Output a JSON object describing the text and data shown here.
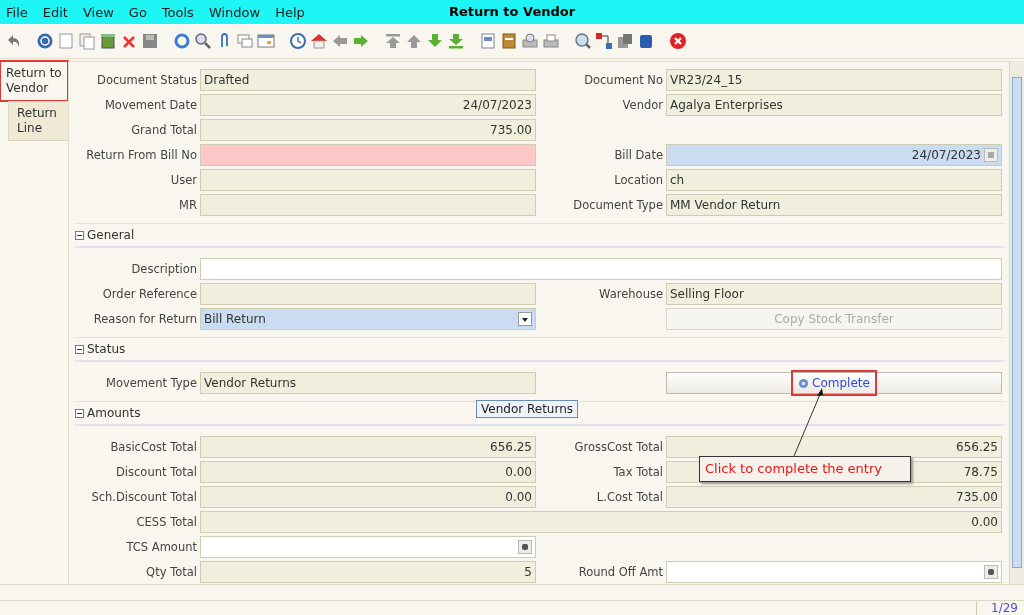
{
  "menu": [
    "File",
    "Edit",
    "View",
    "Go",
    "Tools",
    "Window",
    "Help"
  ],
  "window": {
    "title": "Return to Vendor"
  },
  "tabs": [
    {
      "label": "Return to Vendor",
      "selected": true,
      "highlighted": true
    },
    {
      "label": "Return Line",
      "selected": false,
      "highlighted": false
    }
  ],
  "sections": [
    {
      "rows": [
        {
          "left": {
            "kind": "readonly",
            "label": "Document Status",
            "value": "Drafted"
          },
          "right": {
            "kind": "readonly",
            "label": "Document No",
            "value": "VR23/24_15"
          }
        },
        {
          "left": {
            "kind": "readonly-number",
            "label": "Movement Date",
            "value": "24/07/2023"
          },
          "right": {
            "kind": "readonly",
            "label": "Vendor",
            "value": "Agalya Enterprises"
          }
        },
        {
          "left": {
            "kind": "readonly-number",
            "label": "Grand Total",
            "value": "735.00"
          }
        },
        {
          "left": {
            "kind": "mandatory",
            "label": "Return From Bill No"
          },
          "right": {
            "kind": "date",
            "label": "Bill Date",
            "value": "24/07/2023"
          }
        },
        {
          "left": {
            "kind": "readonly",
            "label": "User"
          },
          "right": {
            "kind": "readonly",
            "label": "Location",
            "value": "ch"
          }
        },
        {
          "left": {
            "kind": "readonly",
            "label": "MR"
          },
          "right": {
            "kind": "readonly",
            "label": "Document Type",
            "value": "MM Vendor Return"
          }
        }
      ]
    },
    {
      "title": "General",
      "expanded": true,
      "rows": [
        {
          "full": {
            "kind": "input",
            "label": "Description"
          }
        },
        {
          "left": {
            "kind": "readonly",
            "label": "Order Reference"
          },
          "right": {
            "kind": "readonly",
            "label": "Warehouse",
            "value": "Selling Floor"
          }
        },
        {
          "left": {
            "kind": "dropdown",
            "label": "Reason for Return",
            "value": "Bill Return"
          },
          "right": {
            "kind": "button",
            "label": "Copy Stock Transfer",
            "disabled": true
          }
        }
      ]
    },
    {
      "title": "Status",
      "expanded": true,
      "rows": [
        {
          "left": {
            "kind": "readonly",
            "label": "Movement Type",
            "value": "Vendor Returns"
          },
          "right": {
            "kind": "action",
            "label": "Complete",
            "disabled": false,
            "highlighted": true
          }
        }
      ]
    },
    {
      "title": "Amounts",
      "expanded": true,
      "rows": [
        {
          "left": {
            "kind": "readonly-number",
            "label": "BasicCost Total",
            "value": "656.25"
          },
          "right": {
            "kind": "readonly-number",
            "label": "GrossCost Total",
            "value": "656.25"
          }
        },
        {
          "left": {
            "kind": "readonly-number",
            "label": "Discount Total",
            "value": "0.00"
          },
          "right": {
            "kind": "readonly-number",
            "label": "Tax Total",
            "value": "78.75"
          }
        },
        {
          "left": {
            "kind": "readonly-number",
            "label": "Sch.Discount Total",
            "value": "0.00"
          },
          "right": {
            "kind": "readonly-number",
            "label": "L.Cost Total",
            "value": "735.00"
          }
        },
        {
          "full": {
            "kind": "readonly-number",
            "label": "CESS Total",
            "value": "0.00"
          }
        },
        {
          "left": {
            "kind": "amount-input",
            "label": "TCS Amount"
          }
        },
        {
          "left": {
            "kind": "readonly-number",
            "label": "Qty Total",
            "value": "5"
          },
          "right": {
            "kind": "amount-input",
            "label": "Round Off Amt"
          }
        }
      ]
    }
  ],
  "tooltip": "Vendor Returns",
  "callout": "Click to complete the entry",
  "status_bar": {
    "page": "1/29"
  }
}
